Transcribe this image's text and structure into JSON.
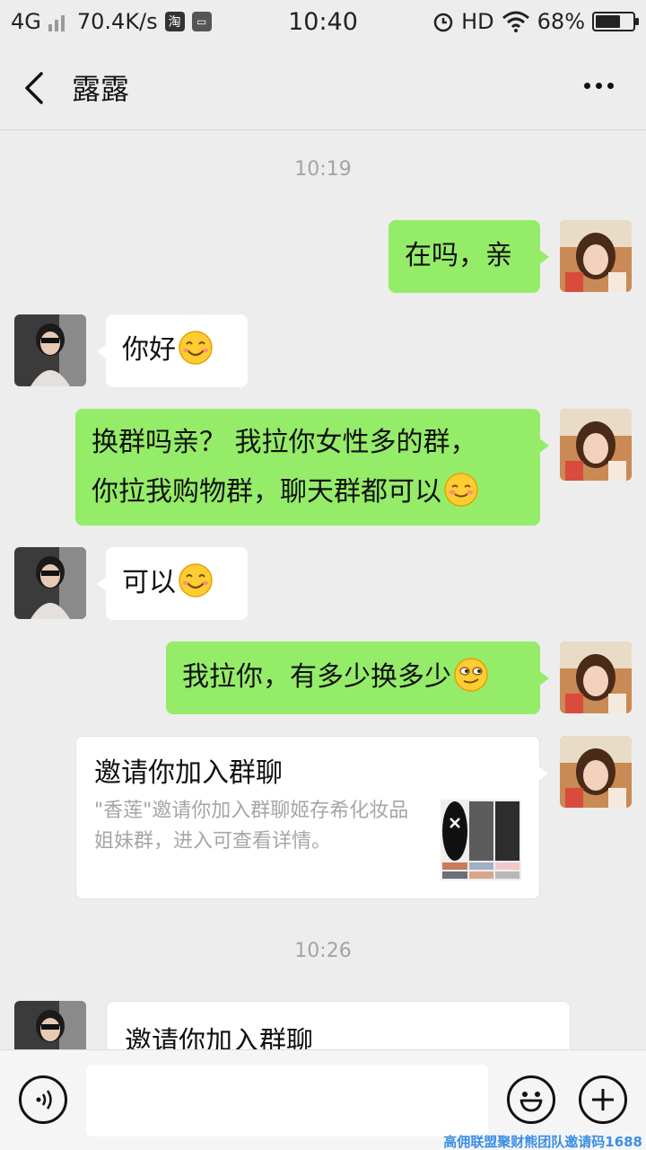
{
  "status_bar": {
    "network": "4G",
    "speed": "70.4K/s",
    "taobao_icon": "淘",
    "time": "10:40",
    "hd": "HD",
    "battery": "68%",
    "battery_level": 0.68
  },
  "header": {
    "title": "露露"
  },
  "messages": {
    "time1": "10:19",
    "m1": "在吗，亲",
    "m2": "你好",
    "m3_line1": "换群吗亲？ 我拉你女性多的群，",
    "m3_line2": "你拉我购物群，聊天群都可以",
    "m4": "可以",
    "m5": "我拉你，有多少换多少",
    "card1": {
      "title": "邀请你加入群聊",
      "desc": "\"香莲\"邀请你加入群聊姬存希化妆品姐妹群，进入可查看详情。"
    },
    "time2": "10:26",
    "card2": {
      "title": "邀请你加入群聊"
    }
  },
  "watermark": "高佣联盟聚财熊团队邀请码1688",
  "colors": {
    "my_bubble": "#95ec69",
    "background": "#ededed",
    "timestamp": "#a4a4a4"
  },
  "icons": [
    "back-arrow-icon",
    "more-icon",
    "voice-icon",
    "emoji-icon",
    "plus-icon",
    "wifi-icon",
    "alarm-icon"
  ]
}
